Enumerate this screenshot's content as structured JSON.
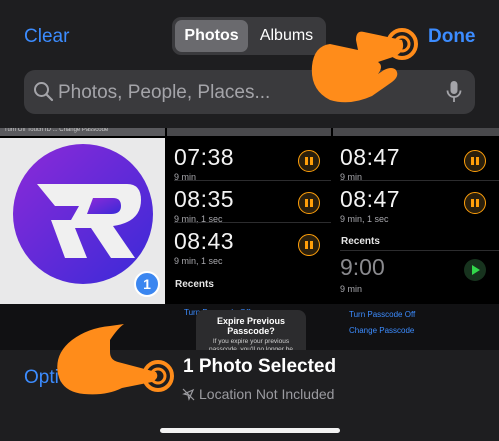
{
  "top_bar": {
    "clear_label": "Clear",
    "done_label": "Done",
    "segments": [
      "Photos",
      "Albums"
    ],
    "active_segment": "Photos"
  },
  "search": {
    "placeholder": "Photos, People, Places...",
    "search_icon": "search-icon",
    "mic_icon": "microphone-icon"
  },
  "grid": {
    "selected_count_badge": "1",
    "logo_letter": "R",
    "alarms_a": [
      {
        "time": "07:38",
        "sub": "9 min"
      },
      {
        "time": "08:35",
        "sub": "9 min, 1 sec"
      },
      {
        "time": "08:43",
        "sub": "9 min, 1 sec"
      }
    ],
    "recents_label": "Recents",
    "alarms_b": [
      {
        "time": "08:47",
        "sub": "9 min"
      },
      {
        "time": "08:47",
        "sub": "9 min, 1 sec"
      }
    ],
    "recent_time": "9:00",
    "recent_sub": "9 min",
    "turn_passcode_off": "Turn Passcode Off",
    "change_passcode": "Change Passcode",
    "dialog_title": "Expire Previous Passcode?",
    "dialog_body": "If you expire your previous passcode, you'll no longer be able to use it to gain access to your device if you forget your new passcode."
  },
  "bottom_bar": {
    "options_label": "Options",
    "selection_title": "1 Photo Selected",
    "location_status": "Location Not Included",
    "location_icon": "location-off-icon"
  },
  "colors": {
    "accent": "#3c8cff",
    "hand": "#ff8c1a",
    "orange": "#ff9f0a",
    "green": "#32d74b"
  }
}
